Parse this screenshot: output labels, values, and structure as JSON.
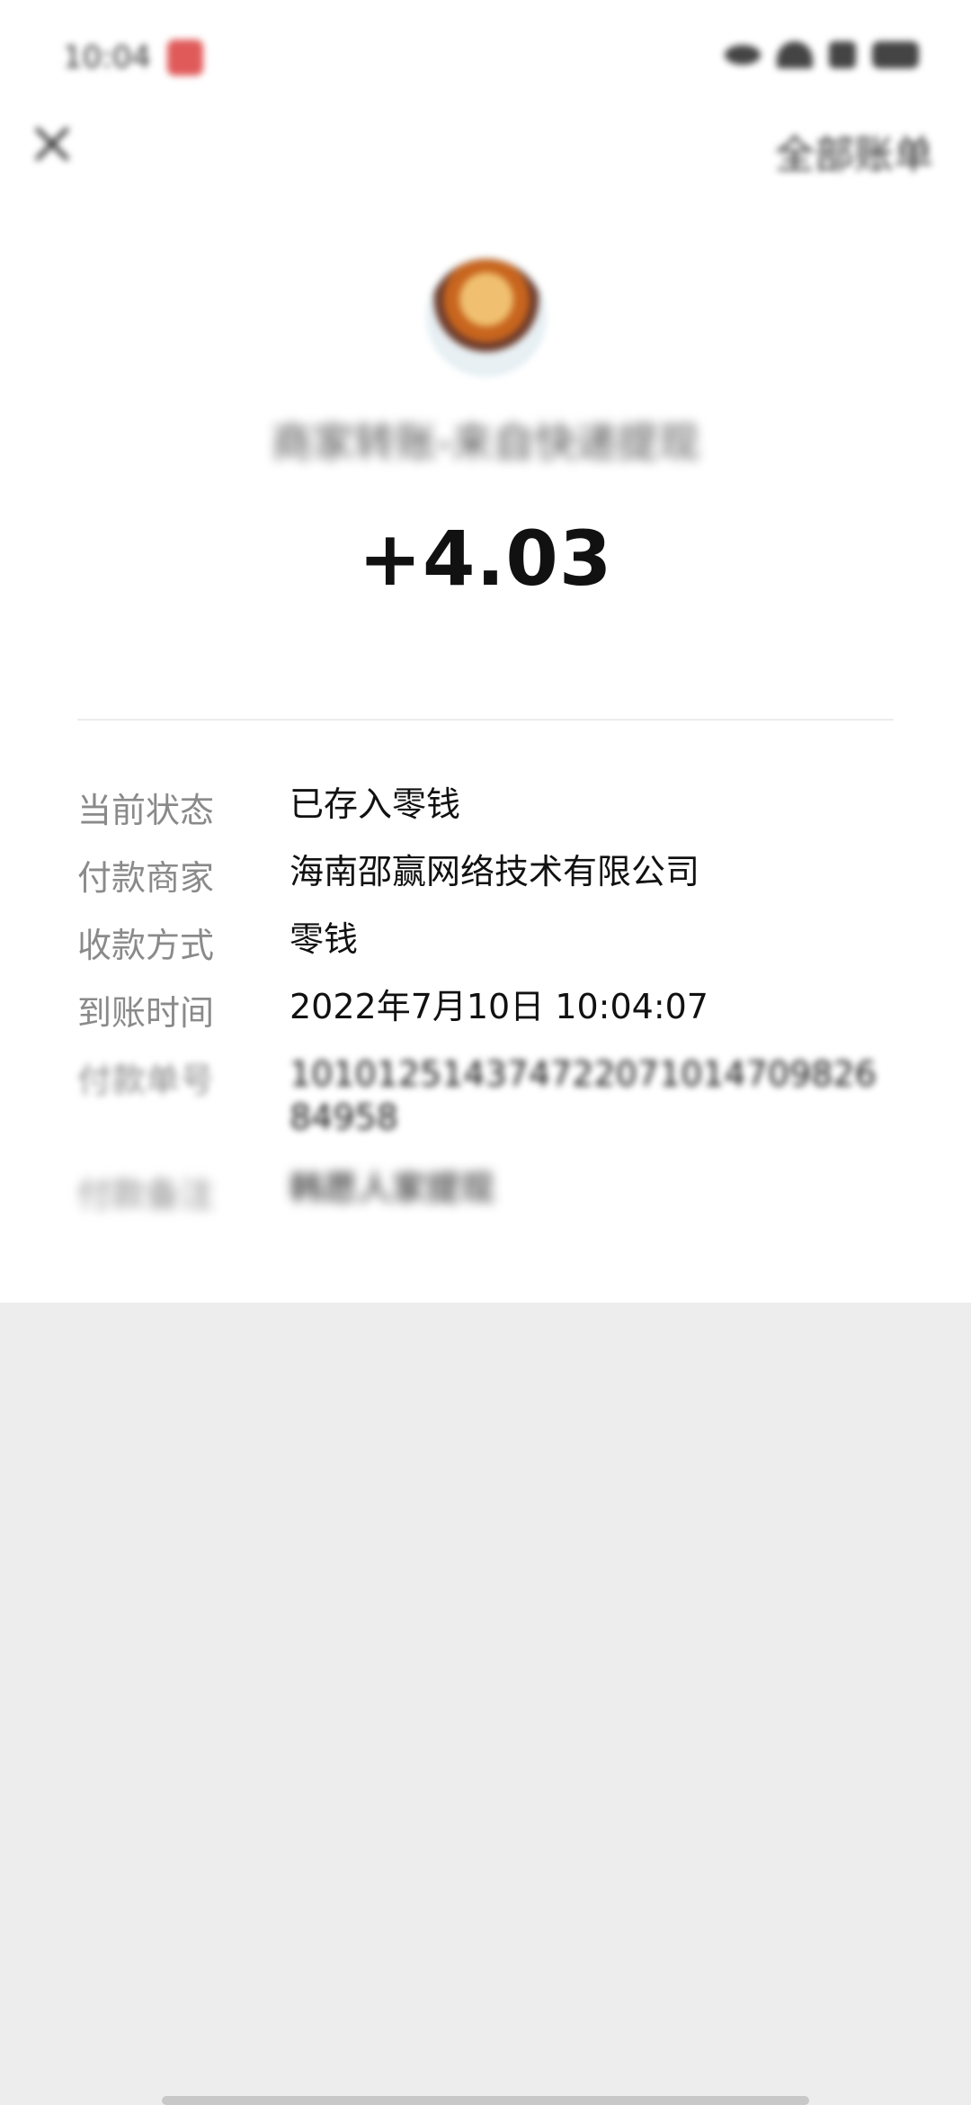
{
  "status_bar": {
    "time": "10:04"
  },
  "nav": {
    "all_bills": "全部账单"
  },
  "header": {
    "merchant_title": "商家转账-来自快递提现",
    "amount": "+4.03"
  },
  "details": [
    {
      "label": "当前状态",
      "value": "已存入零钱"
    },
    {
      "label": "付款商家",
      "value": "海南邵赢网络技术有限公司"
    },
    {
      "label": "收款方式",
      "value": "零钱"
    },
    {
      "label": "到账时间",
      "value": "2022年7月10日 10:04:07"
    },
    {
      "label": "付款单号",
      "value": "10101251437472207101470982684958"
    },
    {
      "label": "付款备注",
      "value": "韩愿人家提现"
    }
  ],
  "colors": {
    "page_background": "#ededed",
    "card_background": "#ffffff",
    "label_text": "#8a8a8a",
    "value_text": "#111111"
  },
  "icons": {
    "close": "close-icon",
    "notification": "notification-badge-icon",
    "eye": "eye-icon",
    "wifi": "wifi-icon",
    "signal": "signal-icon",
    "battery": "battery-icon"
  }
}
